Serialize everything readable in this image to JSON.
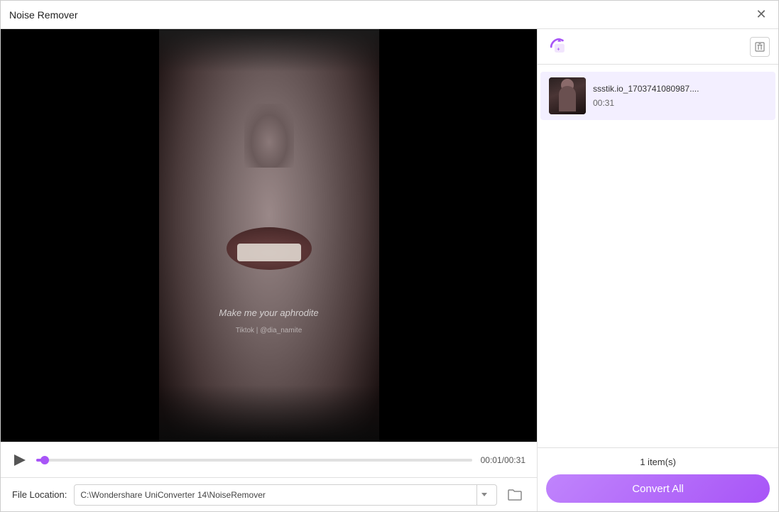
{
  "window": {
    "title": "Noise Remover",
    "close_label": "✕"
  },
  "video": {
    "overlay_text": "Make me your aphrodite",
    "overlay_sub": "Tiktok | @dia_namite",
    "current_time": "00:01",
    "total_time": "00:31",
    "time_display": "00:01/00:31",
    "progress_percent": 2
  },
  "file_location": {
    "label": "File Location:",
    "path": "C:\\Wondershare UniConverter 14\\NoiseRemover",
    "placeholder": "C:\\Wondershare UniConverter 14\\NoiseRemover"
  },
  "right_panel": {
    "file_list": [
      {
        "name": "ssstik.io_1703741080987....",
        "duration": "00:31"
      }
    ],
    "items_count": "1 item(s)",
    "convert_button": "Convert All"
  }
}
